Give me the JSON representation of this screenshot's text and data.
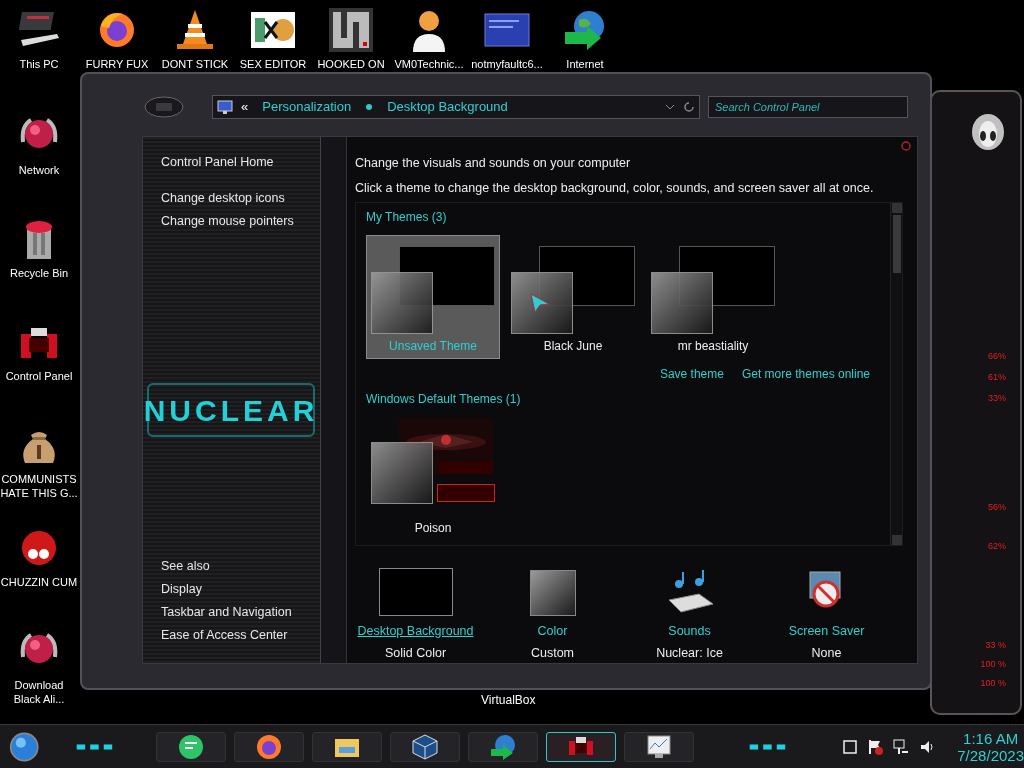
{
  "desktop_icons_top": [
    {
      "label": "This PC"
    },
    {
      "label": "FURRY FUX"
    },
    {
      "label": "DONT STICK"
    },
    {
      "label": "SEX EDITOR"
    },
    {
      "label": "HOOKED ON"
    },
    {
      "label": "VM0Technic..."
    },
    {
      "label": "notmyfaultc6..."
    },
    {
      "label": "Internet"
    }
  ],
  "desktop_icons_left": [
    {
      "label": "Network"
    },
    {
      "label": "Recycle Bin"
    },
    {
      "label": "Control Panel"
    },
    {
      "label": "COMMUNISTS HATE THIS G..."
    },
    {
      "label": "CHUZZIN CUM"
    },
    {
      "label": "Download Black Ali..."
    }
  ],
  "window": {
    "back_glyph": "«",
    "breadcrumb": [
      "Personalization",
      "Desktop Background"
    ],
    "search": {
      "placeholder": "Search Control Panel"
    },
    "sidebar": {
      "links": [
        "Control Panel Home",
        "Change desktop icons",
        "Change mouse pointers"
      ],
      "logo": "NUCLEAR",
      "see_also": "See also",
      "see_also_links": [
        "Display",
        "Taskbar and Navigation",
        "Ease of Access Center"
      ]
    },
    "heading": "Change the visuals and sounds on your computer",
    "description": "Click a theme to change the desktop background, color, sounds, and screen saver all at once.",
    "theme_groups": [
      {
        "title": "My Themes (3)",
        "themes": [
          {
            "name": "Unsaved Theme",
            "selected": true,
            "kind": "plain"
          },
          {
            "name": "Black June",
            "selected": false,
            "kind": "cursor"
          },
          {
            "name": "mr beastiality",
            "selected": false,
            "kind": "plain"
          }
        ],
        "actions": [
          "Save theme",
          "Get more themes online"
        ]
      },
      {
        "title": "Windows Default Themes (1)",
        "themes": [
          {
            "name": "Poison",
            "selected": false,
            "kind": "picture"
          }
        ]
      }
    ],
    "settings": [
      {
        "kind": "background",
        "label": "Desktop Background",
        "value": "Solid Color"
      },
      {
        "kind": "color",
        "label": "Color",
        "value": "Custom"
      },
      {
        "kind": "sounds",
        "label": "Sounds",
        "value": "Nuclear: Ice"
      },
      {
        "kind": "screensaver",
        "label": "Screen Saver",
        "value": "None"
      }
    ]
  },
  "background_label": "VirtualBox",
  "gadget_readings": [
    "66%",
    "61%",
    "33%",
    "56%",
    "62%",
    "33 %",
    "100 %",
    "100 %"
  ],
  "taskbar": {
    "apps": [
      {
        "kind": "notes",
        "selected": false
      },
      {
        "kind": "browser",
        "selected": false
      },
      {
        "kind": "folder",
        "selected": false
      },
      {
        "kind": "cube",
        "selected": false
      },
      {
        "kind": "globe",
        "selected": false
      },
      {
        "kind": "device",
        "selected": true
      },
      {
        "kind": "monitor",
        "selected": false
      }
    ],
    "clock": {
      "time": "1:16 AM",
      "date": "7/28/2023"
    }
  }
}
